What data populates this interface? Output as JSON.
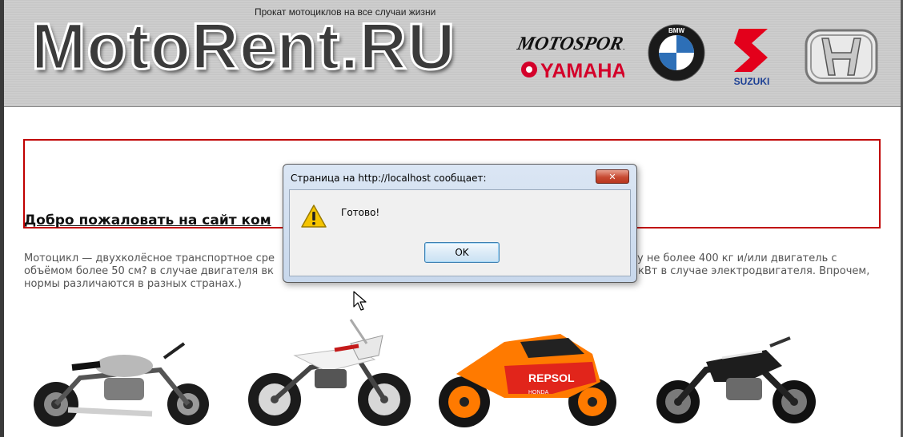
{
  "header": {
    "tagline": "Прокат мотоциклов на все случаи жизни",
    "logo": "MotoRent.RU",
    "brands": {
      "motosport": "MOTOSPORT",
      "yamaha": "YAMAHA",
      "bmw": "BMW",
      "suzuki": "SUZUKI",
      "honda": "HONDA"
    }
  },
  "main": {
    "welcome_title": "Добро пожаловать на сайт ком",
    "intro_lines": [
      "Мотоцикл — двухколёсное транспортное сре",
      "у не более 400 кг и/или двигатель с",
      "объёмом более 50 см? в случае двигателя вк",
      "кВт в случае электродвигателя. Впрочем,",
      "нормы различаются в разных странах.)"
    ]
  },
  "bikes": [
    {
      "name": "cruiser-silver"
    },
    {
      "name": "enduro-white"
    },
    {
      "name": "sportbike-repsol",
      "livery": "REPSOL",
      "maker": "HONDA"
    },
    {
      "name": "muscle-black"
    }
  ],
  "dialog": {
    "title": "Страница на http://localhost сообщает:",
    "message": "Готово!",
    "ok_label": "OK",
    "close_symbol": "✕",
    "icon": "warning-icon"
  },
  "colors": {
    "welcome_border": "#c00000",
    "dialog_frame": "#c8d8ec",
    "close_red": "#c74a32"
  }
}
